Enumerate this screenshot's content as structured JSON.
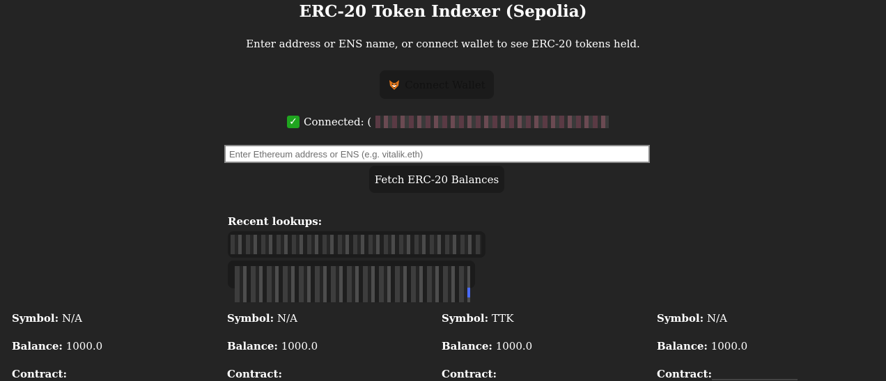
{
  "header": {
    "title": "ERC-20 Token Indexer (Sepolia)",
    "subtitle": "Enter address or ENS name, or connect wallet to see ERC-20 tokens held."
  },
  "wallet": {
    "connect_label": "Connect Wallet",
    "connected_label": "Connected: ("
  },
  "search": {
    "placeholder": "Enter Ethereum address or ENS (e.g. vitalik.eth)",
    "value": "",
    "fetch_label": "Fetch ERC-20 Balances"
  },
  "recent": {
    "title": "Recent lookups:"
  },
  "labels": {
    "symbol": "Symbol:",
    "balance": "Balance:",
    "contract": "Contract:"
  },
  "tokens": [
    {
      "symbol": "N/A",
      "balance": "1000.0"
    },
    {
      "symbol": "N/A",
      "balance": "1000.0"
    },
    {
      "symbol": "TTK",
      "balance": "1000.0"
    },
    {
      "symbol": "N/A",
      "balance": "1000.0"
    }
  ],
  "icons": {
    "wallet_icon": "fox-icon",
    "connected_icon": "check-icon"
  },
  "colors": {
    "background": "#242424",
    "button": "#1b1b1b",
    "check": "#1fa51f"
  }
}
